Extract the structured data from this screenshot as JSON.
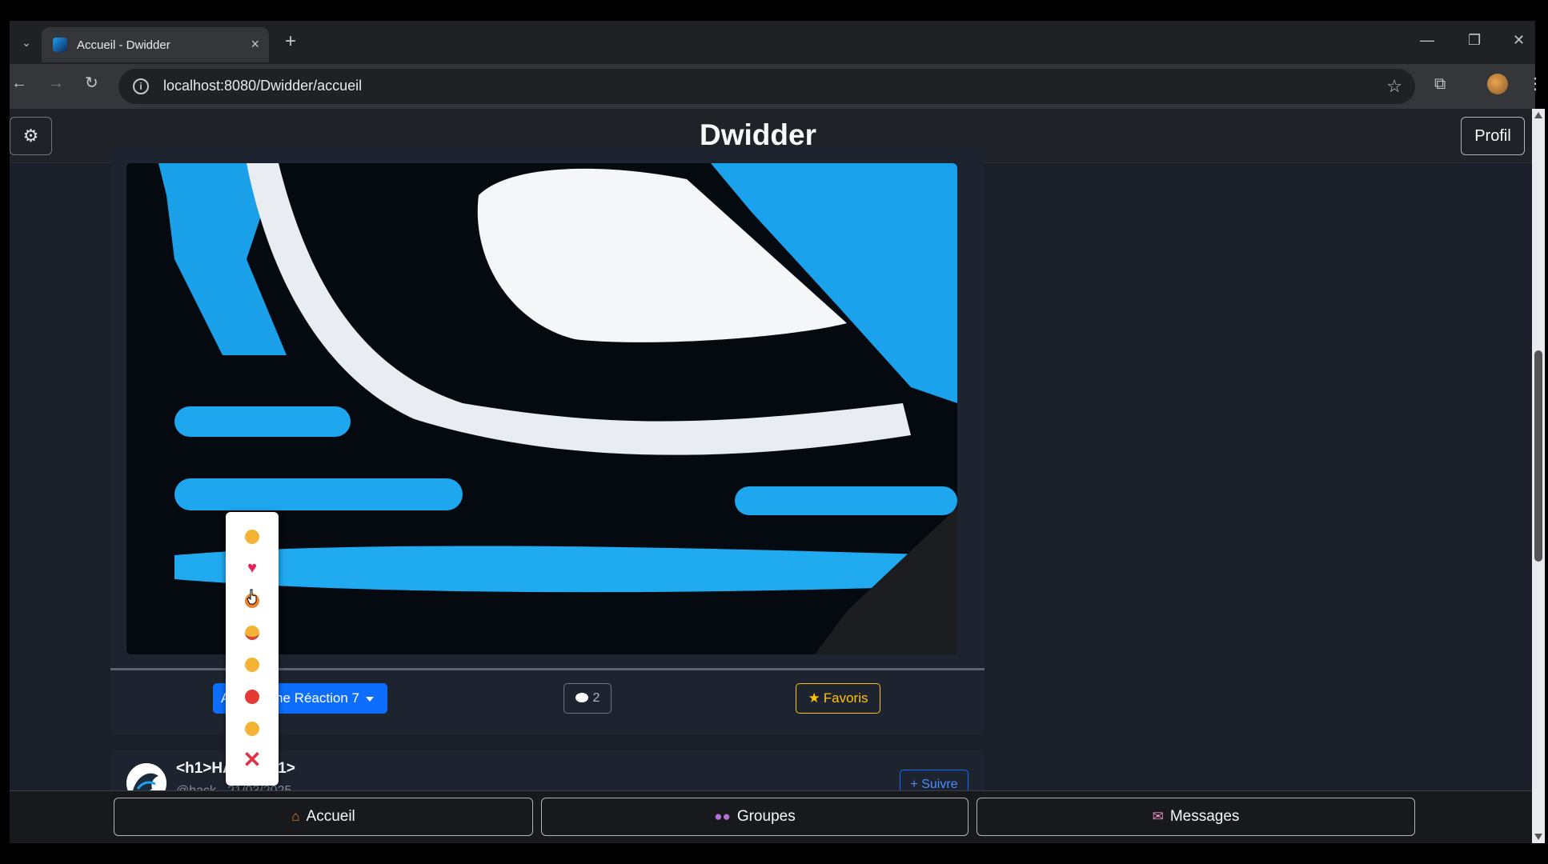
{
  "browser": {
    "tab_title": "Accueil - Dwidder",
    "url": "localhost:8080/Dwidder/accueil",
    "new_tab": "+",
    "close_tab": "×",
    "minimize": "—",
    "restore": "❐",
    "close_window": "✕"
  },
  "navbar": {
    "brand": "Dwidder",
    "settings_icon": "gear-icon",
    "profile_label": "Profil"
  },
  "post": {
    "reaction_button_label": "Ajouter une Réaction 7",
    "comment_count": "2",
    "favorites_label": "Favoris",
    "reactions_menu": [
      {
        "name": "thumbs-up",
        "glyph": "👍",
        "color": "#f5b335"
      },
      {
        "name": "heart",
        "glyph": "❤",
        "color": "#e0245e"
      },
      {
        "name": "fire",
        "glyph": "🔥",
        "color": "#f0812b"
      },
      {
        "name": "laughing",
        "glyph": "😂",
        "color": "#f5b335"
      },
      {
        "name": "surprised",
        "glyph": "😮",
        "color": "#f5b335"
      },
      {
        "name": "angry",
        "glyph": "😡",
        "color": "#e53935"
      },
      {
        "name": "thinking",
        "glyph": "🤔",
        "color": "#f5b335"
      },
      {
        "name": "close",
        "glyph": "✕",
        "color": "#dc3545"
      }
    ]
  },
  "next_post": {
    "author_name": "<h1>HACK</h1>",
    "author_meta": "@hack - 21/03/2025",
    "follow_label": "+ Suivre"
  },
  "bottom_nav": {
    "home": "Accueil",
    "groups": "Groupes",
    "messages": "Messages"
  },
  "colors": {
    "primary": "#0d6efd",
    "warning": "#ffc107",
    "background": "#1a1f2a"
  }
}
